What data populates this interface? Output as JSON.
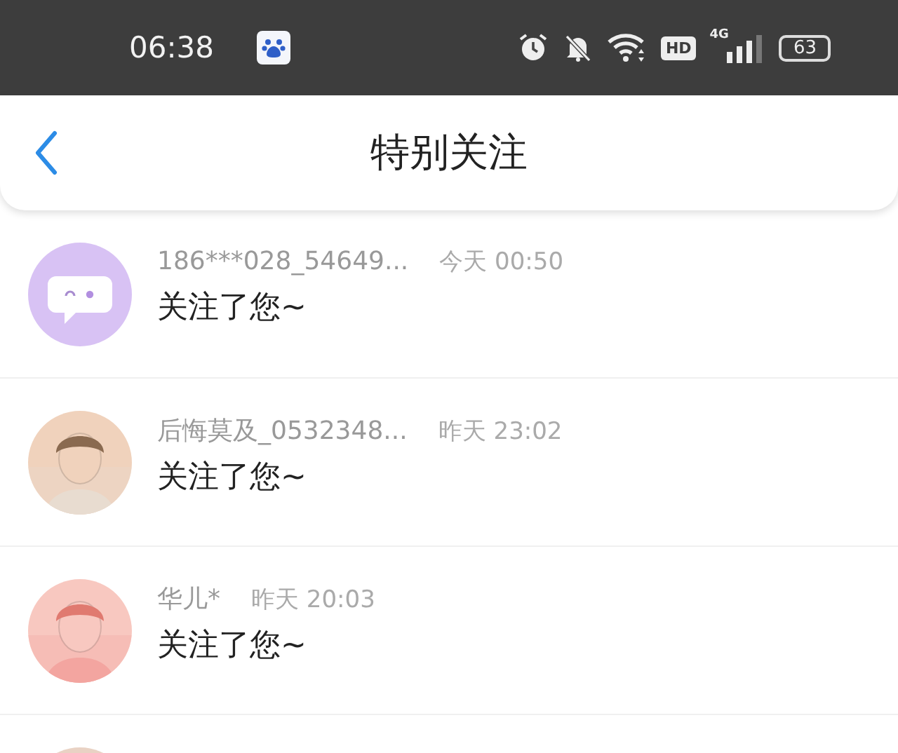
{
  "status_bar": {
    "time": "06:38",
    "hd": "HD",
    "network": "4G",
    "battery": "63"
  },
  "header": {
    "title": "特别关注"
  },
  "items": [
    {
      "kind": "default",
      "name": "186***028_54649...",
      "time": "今天 00:50",
      "message": "关注了您~"
    },
    {
      "kind": "picture",
      "name": "后悔莫及_0532348...",
      "time": "昨天 23:02",
      "message": "关注了您~"
    },
    {
      "kind": "picture",
      "name": "华儿*",
      "time": "昨天 20:03",
      "message": "关注了您~"
    },
    {
      "kind": "picture"
    }
  ]
}
